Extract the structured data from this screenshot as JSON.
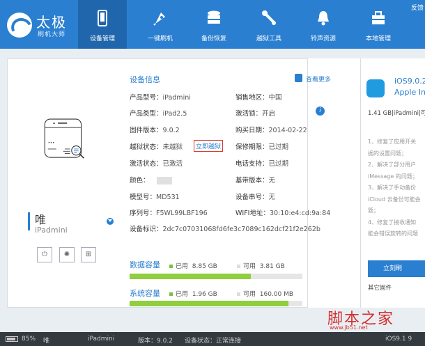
{
  "app": {
    "brand_big": "太极",
    "brand_small": "刷机大师",
    "feedback": "反馈"
  },
  "nav": [
    {
      "label": "设备管理",
      "icon": "phone-icon",
      "active": true
    },
    {
      "label": "一键刷机",
      "icon": "rocket-icon",
      "active": false
    },
    {
      "label": "备份恢复",
      "icon": "database-icon",
      "active": false
    },
    {
      "label": "越狱工具",
      "icon": "wrench-icon",
      "active": false
    },
    {
      "label": "铃声资源",
      "icon": "bell-icon",
      "active": false
    },
    {
      "label": "本地管理",
      "icon": "briefcase-icon",
      "active": false
    }
  ],
  "device": {
    "name": "唯",
    "model": "iPadmini",
    "buttons": [
      "⏻",
      "✺",
      "⊞"
    ]
  },
  "info": {
    "title": "设备信息",
    "more": "查看更多",
    "left": [
      {
        "label": "产品型号：",
        "value": "iPadmini"
      },
      {
        "label": "产品类型：",
        "value": "iPad2,5"
      },
      {
        "label": "固件版本：",
        "value": "9.0.2"
      },
      {
        "label": "越狱状态：",
        "value": "未越狱"
      },
      {
        "label": "激活状态：",
        "value": "已激活"
      },
      {
        "label": "颜色：",
        "value": ""
      },
      {
        "label": "模型号：",
        "value": "MD531"
      },
      {
        "label": "序列号：",
        "value": "F5WL99LBF196"
      }
    ],
    "jailbreak_link": "立即越狱",
    "right": [
      {
        "label": "销售地区：",
        "value": "中国"
      },
      {
        "label": "激活锁：",
        "value": "开启"
      },
      {
        "label": "购买日期：",
        "value": "2014-02-22"
      },
      {
        "label": "保修期限：",
        "value": "已过期"
      },
      {
        "label": "电话支持：",
        "value": "已过期"
      },
      {
        "label": "基带版本：",
        "value": "无"
      },
      {
        "label": "设备串号：",
        "value": "无"
      },
      {
        "label": "WIFI地址：",
        "value": "30:10:e4:cd:9a:84"
      }
    ],
    "udid_label": "设备标识：",
    "udid_value": "2dc7c07031068fd6fe3c7089c162dcf21f2e262b"
  },
  "capacity": {
    "data": {
      "title": "数据容量",
      "used_label": "已用",
      "used": "8.85 GB",
      "free_label": "可用",
      "free": "3.81 GB",
      "used_fraction": 0.7
    },
    "system": {
      "title": "系统容量",
      "used_label": "已用",
      "used": "1.96 GB",
      "free_label": "可用",
      "free": "160.00 MB",
      "used_fraction": 0.92
    }
  },
  "right_panel": {
    "ios_name": "iOS9.0.2",
    "ios_sub": "Apple In",
    "size": "1.41 GB|iPadmini|可",
    "notes": [
      "1、修复了应用开关",
      "据的设置问题；",
      "2、解决了部分用户",
      "iMessage 的问题；",
      "3、解决了手动备份",
      "iCloud 云备份可能会",
      "题；",
      "4、修复了接收通知",
      "能会错误旋转的问题"
    ],
    "flash_button": "立刻刷",
    "other_firmware": "其它固件"
  },
  "statusbar": {
    "battery": "85%",
    "user": "唯",
    "device": "iPadmini",
    "version_label": "版本：",
    "version": "9.0.2",
    "status_label": "设备状态：",
    "status": "正常连接",
    "right_version": "iOS9.1 9"
  },
  "watermark": {
    "text": "脚本之家",
    "url": "www.jb51.net"
  },
  "colors": {
    "accent": "#2a7fd0",
    "nav_active": "#1f66ad",
    "capacity_used": "#8fce3f",
    "jailbreak_highlight": "#d9372b"
  }
}
